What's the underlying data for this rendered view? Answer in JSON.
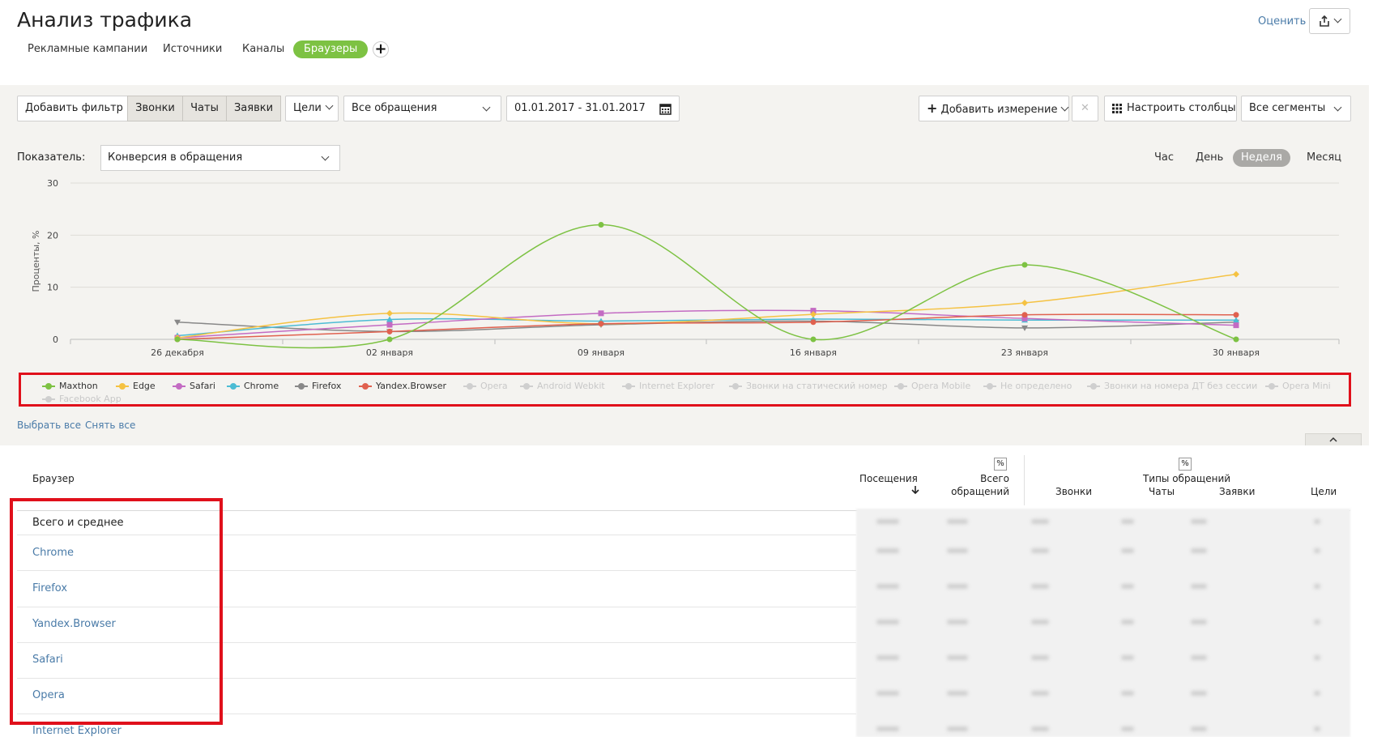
{
  "header": {
    "title": "Анализ трафика",
    "tabs": [
      {
        "label": "Рекламные кампании",
        "active": false
      },
      {
        "label": "Источники",
        "active": false
      },
      {
        "label": "Каналы",
        "active": false
      },
      {
        "label": "Браузеры",
        "active": true
      }
    ],
    "add_tab_icon": "plus-icon",
    "rate_label": "Оценить",
    "export_icon": "share-icon"
  },
  "toolbar": {
    "add_filter": "Добавить фильтр",
    "types": [
      "Звонки",
      "Чаты",
      "Заявки"
    ],
    "goals": "Цели",
    "appeals_select": "Все обращения",
    "date_range": "01.01.2017 - 31.01.2017",
    "calendar_icon": "calendar-icon",
    "add_dimension": "Добавить измерение",
    "clear_icon": "close-icon",
    "configure_columns": "Настроить столбцы",
    "segments_select": "Все сегменты"
  },
  "indicator": {
    "label": "Показатель:",
    "value": "Конверсия в обращения"
  },
  "periods": [
    {
      "label": "Час",
      "active": false
    },
    {
      "label": "День",
      "active": false
    },
    {
      "label": "Неделя",
      "active": true
    },
    {
      "label": "Месяц",
      "active": false
    }
  ],
  "chart_data": {
    "type": "line",
    "ylabel": "Проценты, %",
    "ylim": [
      0,
      30
    ],
    "yticks": [
      0,
      10,
      20,
      30
    ],
    "categories": [
      "26 декабря",
      "02 января",
      "09 января",
      "16 января",
      "23 января",
      "30 января"
    ],
    "grid": true,
    "legend_position": "bottom",
    "series": [
      {
        "name": "Maxthon",
        "color": "#7dc243",
        "marker": "circle",
        "values": [
          0,
          0,
          22,
          0,
          14.3,
          0
        ]
      },
      {
        "name": "Edge",
        "color": "#f5c242",
        "marker": "diamond",
        "values": [
          0.3,
          5,
          3,
          4.8,
          7,
          12.5
        ]
      },
      {
        "name": "Safari",
        "color": "#c36bc3",
        "marker": "square",
        "values": [
          0.3,
          2.8,
          5,
          5.5,
          4,
          2.7
        ]
      },
      {
        "name": "Chrome",
        "color": "#4cbcd4",
        "marker": "triangle",
        "values": [
          0.7,
          3.8,
          3.5,
          3.9,
          3.7,
          3.7
        ]
      },
      {
        "name": "Firefox",
        "color": "#888888",
        "marker": "triangle-down",
        "values": [
          3.3,
          1.5,
          2.8,
          3.5,
          2.2,
          3.3
        ]
      },
      {
        "name": "Yandex.Browser",
        "color": "#e0614f",
        "marker": "circle",
        "values": [
          0,
          1.5,
          3,
          3.3,
          4.7,
          4.7
        ]
      }
    ],
    "hidden_series": [
      "Opera",
      "Android Webkit",
      "Internet Explorer",
      "Звонки на статический номер",
      "Opera Mobile",
      "Не определено",
      "Звонки на номера ДТ без сессии",
      "Opera Mini",
      "Facebook App"
    ]
  },
  "legend_actions": {
    "select_all": "Выбрать все",
    "deselect_all": "Снять все"
  },
  "table": {
    "browser_header": "Браузер",
    "visits_header": "Посещения",
    "total_header_1": "Всего",
    "total_header_2": "обращений",
    "types_header": "Типы обращений",
    "calls_header": "Звонки",
    "chats_header": "Чаты",
    "requests_header": "Заявки",
    "goals_header": "Цели",
    "pct_symbol": "%",
    "total_row": "Всего и среднее",
    "rows": [
      "Chrome",
      "Firefox",
      "Yandex.Browser",
      "Safari",
      "Opera",
      "Internet Explorer"
    ]
  }
}
